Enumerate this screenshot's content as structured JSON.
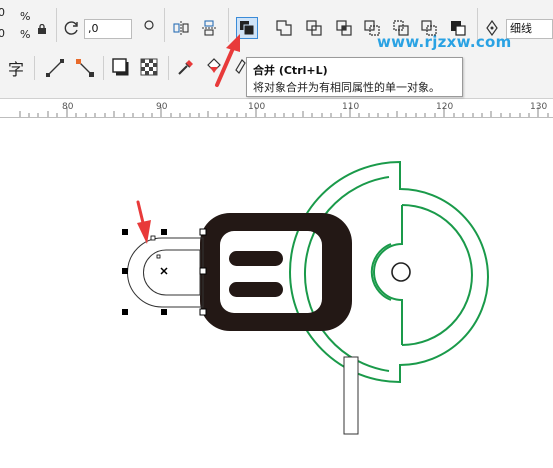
{
  "toolbar": {
    "size_value_top": "0",
    "size_value_bottom": "0",
    "percent_top": "%",
    "percent_bottom": "%",
    "rotation_value": ",0",
    "outline_select_value": "细线",
    "watermark": "www.rjzxw.com"
  },
  "toolbar2": {
    "text_tool_glyph": "字"
  },
  "tooltip": {
    "title": "合并 (Ctrl+L)",
    "description": "将对象合并为有相同属性的单一对象。"
  },
  "ruler": {
    "labels": [
      "80",
      "90",
      "100",
      "110",
      "120",
      "130"
    ]
  },
  "colors": {
    "accent_blue": "#3a8bd8",
    "green_outline": "#1a9a4a",
    "dark_shape": "#231815",
    "arrow_red": "#e83a3a",
    "watermark_blue": "#2aa2e3"
  },
  "icons": [
    "lock-icon",
    "rotate-icon",
    "mirror-horizontal-icon",
    "mirror-vertical-icon",
    "combine-icon",
    "weld-icon",
    "trim-icon",
    "intersect-icon",
    "simplify-icon",
    "front-minus-back-icon",
    "back-minus-front-icon",
    "boundary-icon",
    "pen-nib-icon",
    "text-icon",
    "line-tool-icon",
    "connector-icon",
    "drop-shadow-icon",
    "transparency-icon",
    "eyedropper-icon",
    "fill-bucket-icon"
  ]
}
